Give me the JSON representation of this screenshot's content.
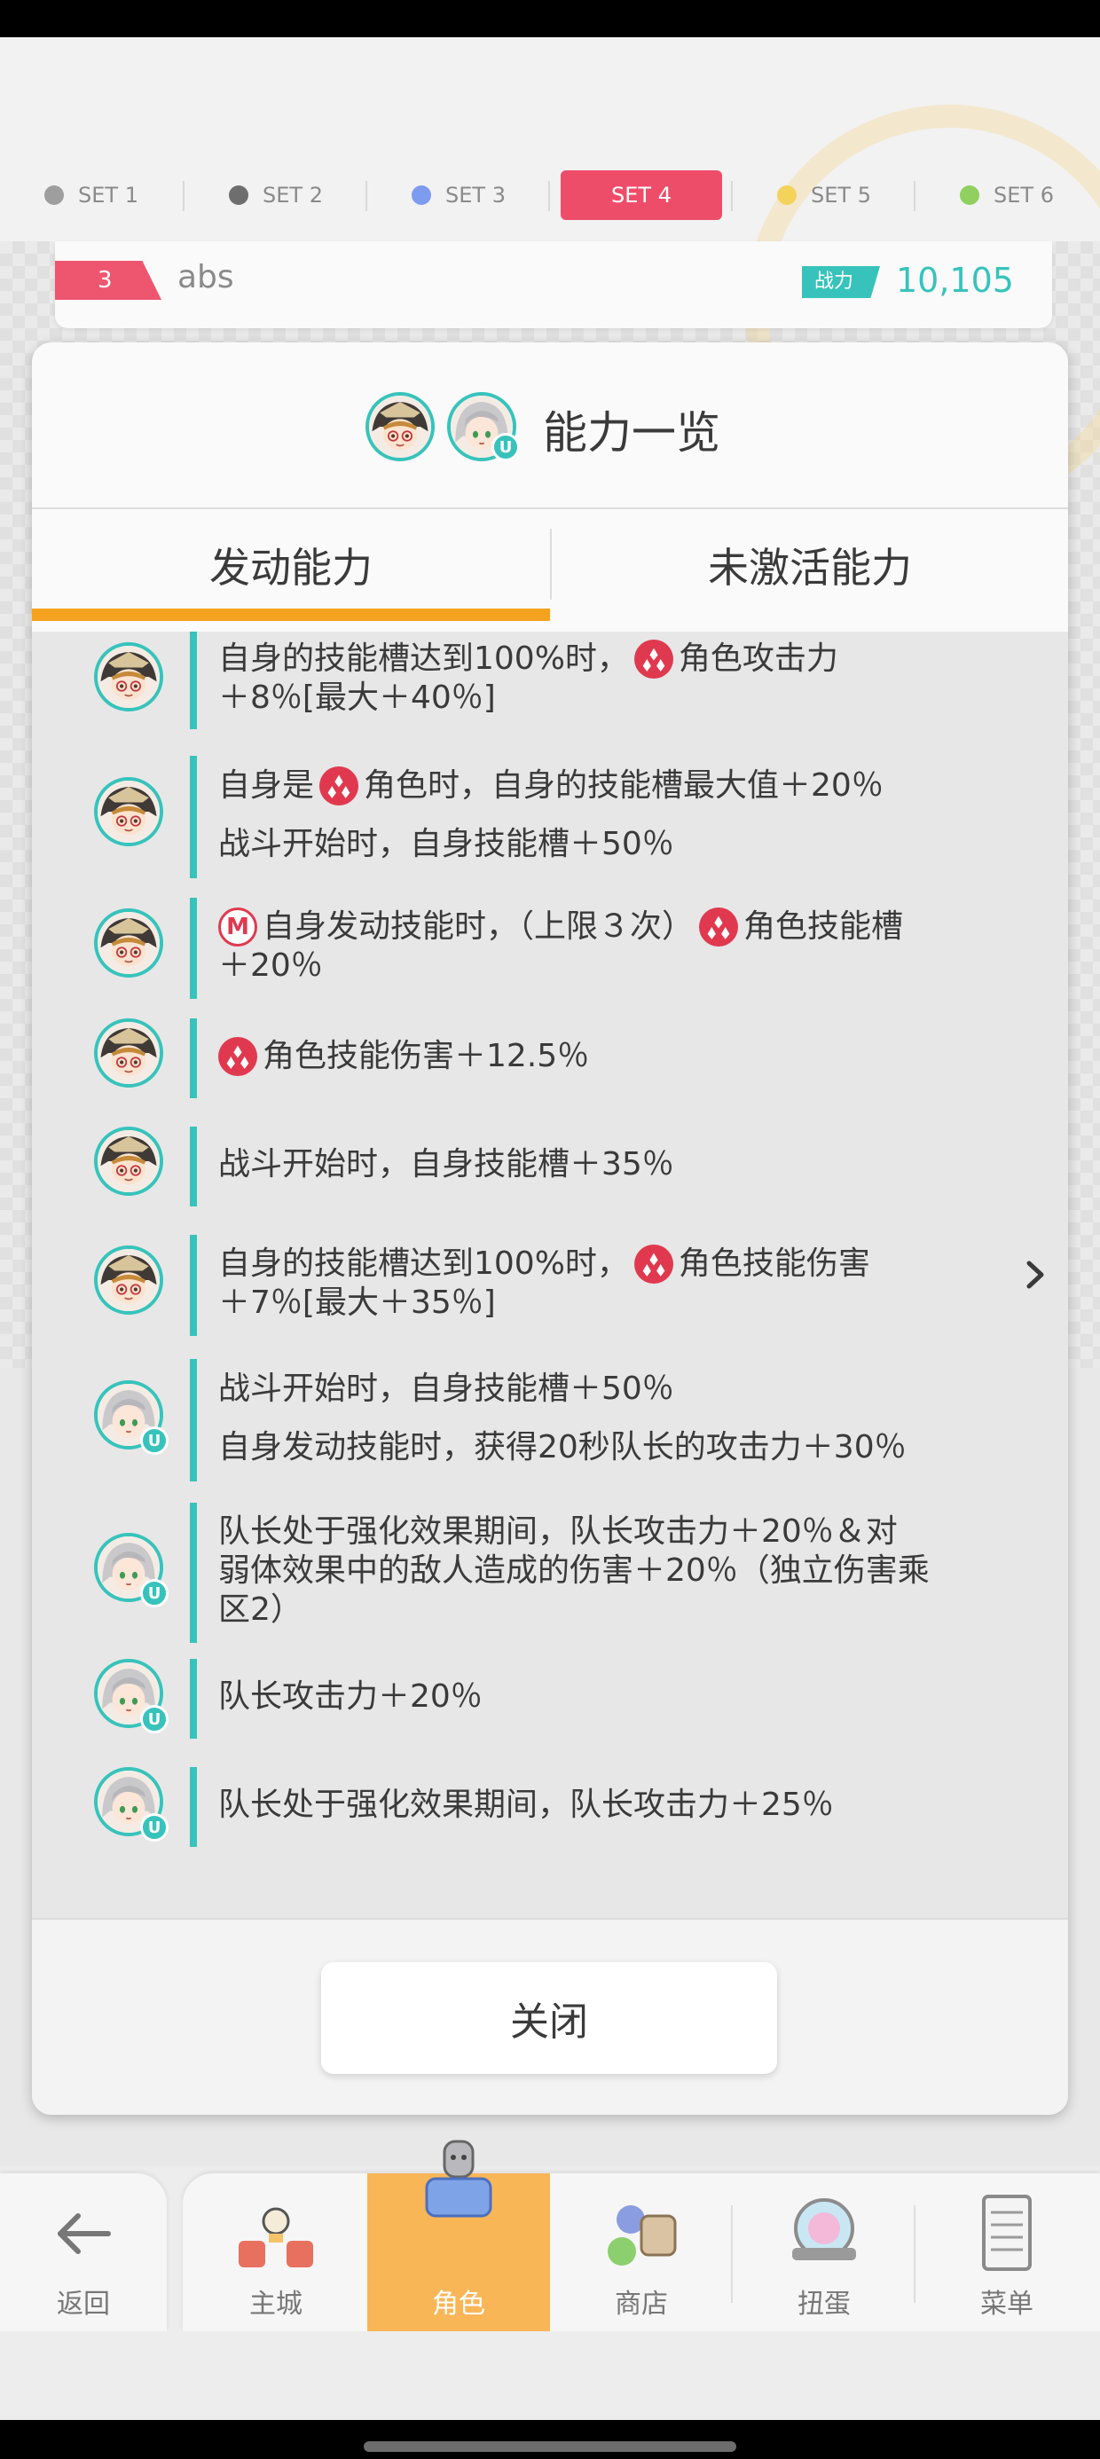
{
  "set_tabs": [
    {
      "label": "SET 1",
      "dot_color": "#9e9e9e",
      "active": false
    },
    {
      "label": "SET 2",
      "dot_color": "#6e6e6e",
      "active": false
    },
    {
      "label": "SET 3",
      "dot_color": "#7d9cf0",
      "active": false
    },
    {
      "label": "SET 4",
      "dot_color": "#ee4d6a",
      "active": true
    },
    {
      "label": "SET 5",
      "dot_color": "#f3d35a",
      "active": false
    },
    {
      "label": "SET 6",
      "dot_color": "#8fd05f",
      "active": false
    }
  ],
  "team": {
    "number": "3",
    "name": "abs",
    "power_label": "战力",
    "power_value": "10,105"
  },
  "dialog": {
    "title": "能力一览",
    "tabs": [
      {
        "label": "发动能力",
        "active": true
      },
      {
        "label": "未激活能力",
        "active": false
      }
    ],
    "close_label": "关闭"
  },
  "abilities": [
    {
      "character": "character-a",
      "badge": "",
      "lines": [
        [
          {
            "t": "text",
            "v": "自身的技能槽达到100%时，"
          },
          {
            "t": "element-icon"
          },
          {
            "t": "text",
            "v": "角色攻击力"
          }
        ],
        [
          {
            "t": "cont",
            "v": "＋8％[最大＋40％]"
          }
        ]
      ]
    },
    {
      "character": "character-a",
      "badge": "",
      "lines": [
        [
          {
            "t": "text",
            "v": "自身是"
          },
          {
            "t": "element-icon"
          },
          {
            "t": "text",
            "v": "角色时，自身的技能槽最大值＋20％"
          }
        ],
        [
          {
            "t": "text",
            "v": "战斗开始时，自身技能槽＋50％"
          }
        ]
      ]
    },
    {
      "character": "character-a",
      "badge": "",
      "lines": [
        [
          {
            "t": "m-icon"
          },
          {
            "t": "text",
            "v": "自身发动技能时，（上限３次）"
          },
          {
            "t": "element-icon"
          },
          {
            "t": "text",
            "v": "角色技能槽"
          }
        ],
        [
          {
            "t": "cont",
            "v": "＋20％"
          }
        ]
      ]
    },
    {
      "character": "character-a",
      "badge": "",
      "lines": [
        [
          {
            "t": "element-icon"
          },
          {
            "t": "text",
            "v": "角色技能伤害＋12.5％"
          }
        ]
      ]
    },
    {
      "character": "character-a",
      "badge": "",
      "lines": [
        [
          {
            "t": "text",
            "v": "战斗开始时，自身技能槽＋35％"
          }
        ]
      ]
    },
    {
      "character": "character-a",
      "badge": "",
      "lines": [
        [
          {
            "t": "text",
            "v": "自身的技能槽达到100%时，"
          },
          {
            "t": "element-icon"
          },
          {
            "t": "text",
            "v": "角色技能伤害"
          }
        ],
        [
          {
            "t": "cont",
            "v": "＋7％[最大＋35％]"
          }
        ]
      ]
    },
    {
      "character": "character-b",
      "badge": "U",
      "lines": [
        [
          {
            "t": "text",
            "v": "战斗开始时，自身技能槽＋50％"
          }
        ],
        [
          {
            "t": "text",
            "v": "自身发动技能时，获得20秒队长的攻击力＋30％"
          }
        ]
      ]
    },
    {
      "character": "character-b",
      "badge": "U",
      "lines": [
        [
          {
            "t": "text",
            "v": "队长处于强化效果期间，队长攻击力＋20％＆对"
          }
        ],
        [
          {
            "t": "cont",
            "v": "弱体效果中的敌人造成的伤害＋20％（独立伤害乘"
          }
        ],
        [
          {
            "t": "cont",
            "v": "区2）"
          }
        ]
      ]
    },
    {
      "character": "character-b",
      "badge": "U",
      "lines": [
        [
          {
            "t": "text",
            "v": "队长攻击力＋20％"
          }
        ]
      ]
    },
    {
      "character": "character-b",
      "badge": "U",
      "lines": [
        [
          {
            "t": "text",
            "v": "队长处于强化效果期间，队长攻击力＋25％"
          }
        ]
      ]
    }
  ],
  "header_avatars": [
    {
      "character": "character-a",
      "badge": ""
    },
    {
      "character": "character-b",
      "badge": "U"
    }
  ],
  "bottom_nav": {
    "back_label": "返回",
    "items": [
      {
        "label": "主城",
        "icon": "castle-icon",
        "active": false
      },
      {
        "label": "角色",
        "icon": "character-icon",
        "active": true
      },
      {
        "label": "商店",
        "icon": "shop-icon",
        "active": false
      },
      {
        "label": "扭蛋",
        "icon": "gacha-icon",
        "active": false
      },
      {
        "label": "菜单",
        "icon": "menu-icon",
        "active": false
      }
    ]
  },
  "colors": {
    "accent_teal": "#37c3bb",
    "accent_orange": "#f5a21f",
    "set_active": "#ee4d6a",
    "element_red": "#e0394f"
  }
}
